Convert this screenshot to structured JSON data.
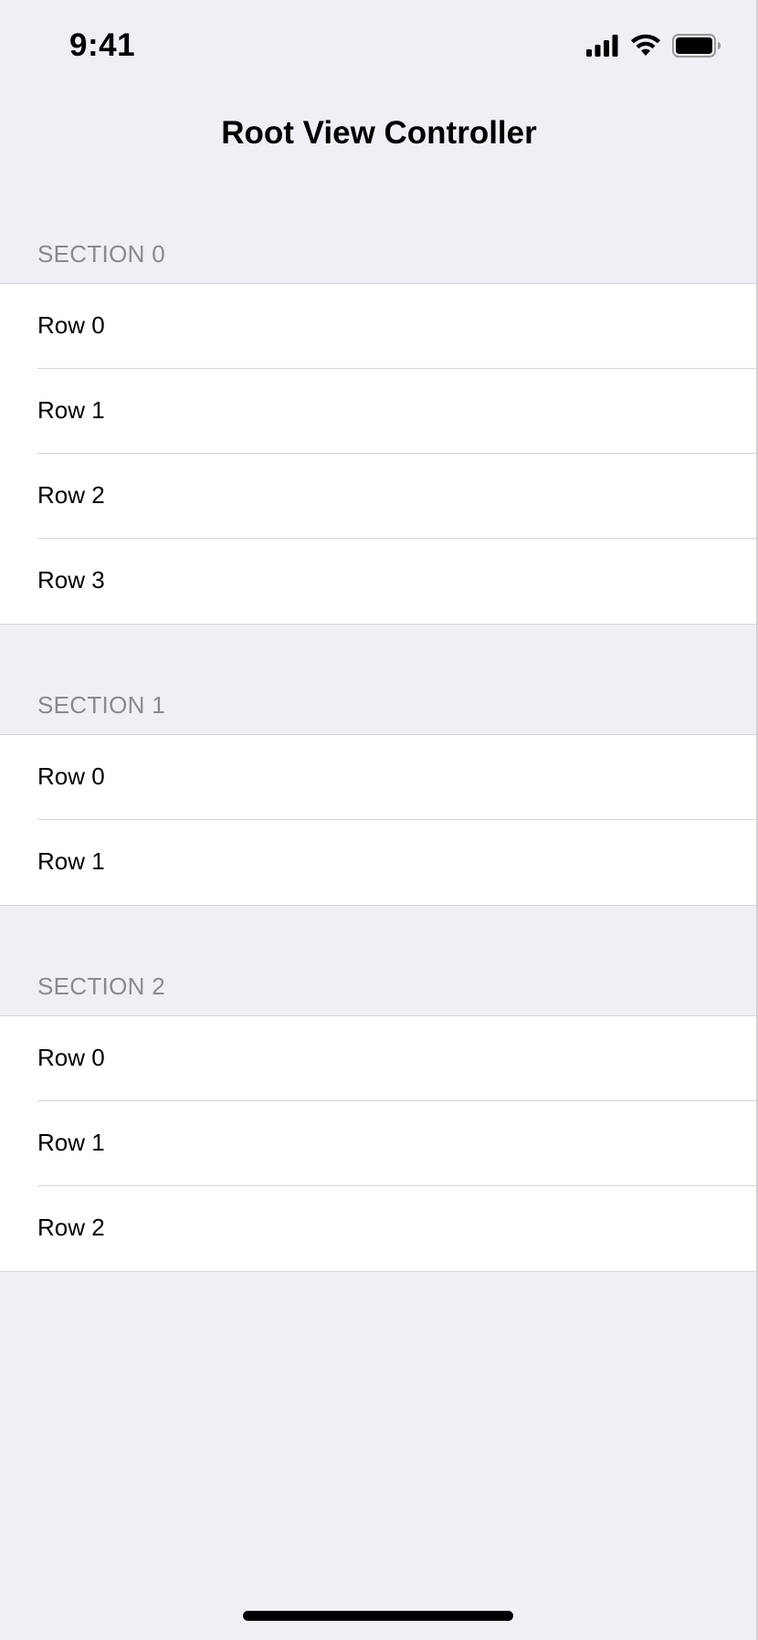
{
  "status_bar": {
    "time": "9:41",
    "icons": [
      "cellular-signal-icon",
      "wifi-icon",
      "battery-icon"
    ]
  },
  "nav": {
    "title": "Root View Controller"
  },
  "sections": [
    {
      "header": "SECTION 0",
      "rows": [
        "Row 0",
        "Row 1",
        "Row 2",
        "Row 3"
      ]
    },
    {
      "header": "SECTION 1",
      "rows": [
        "Row 0",
        "Row 1"
      ]
    },
    {
      "header": "SECTION 2",
      "rows": [
        "Row 0",
        "Row 1",
        "Row 2"
      ]
    }
  ],
  "colors": {
    "background": "#f0eff5",
    "cell": "#ffffff",
    "header_text": "#8a8a8e",
    "separator": "#d6d6da"
  }
}
